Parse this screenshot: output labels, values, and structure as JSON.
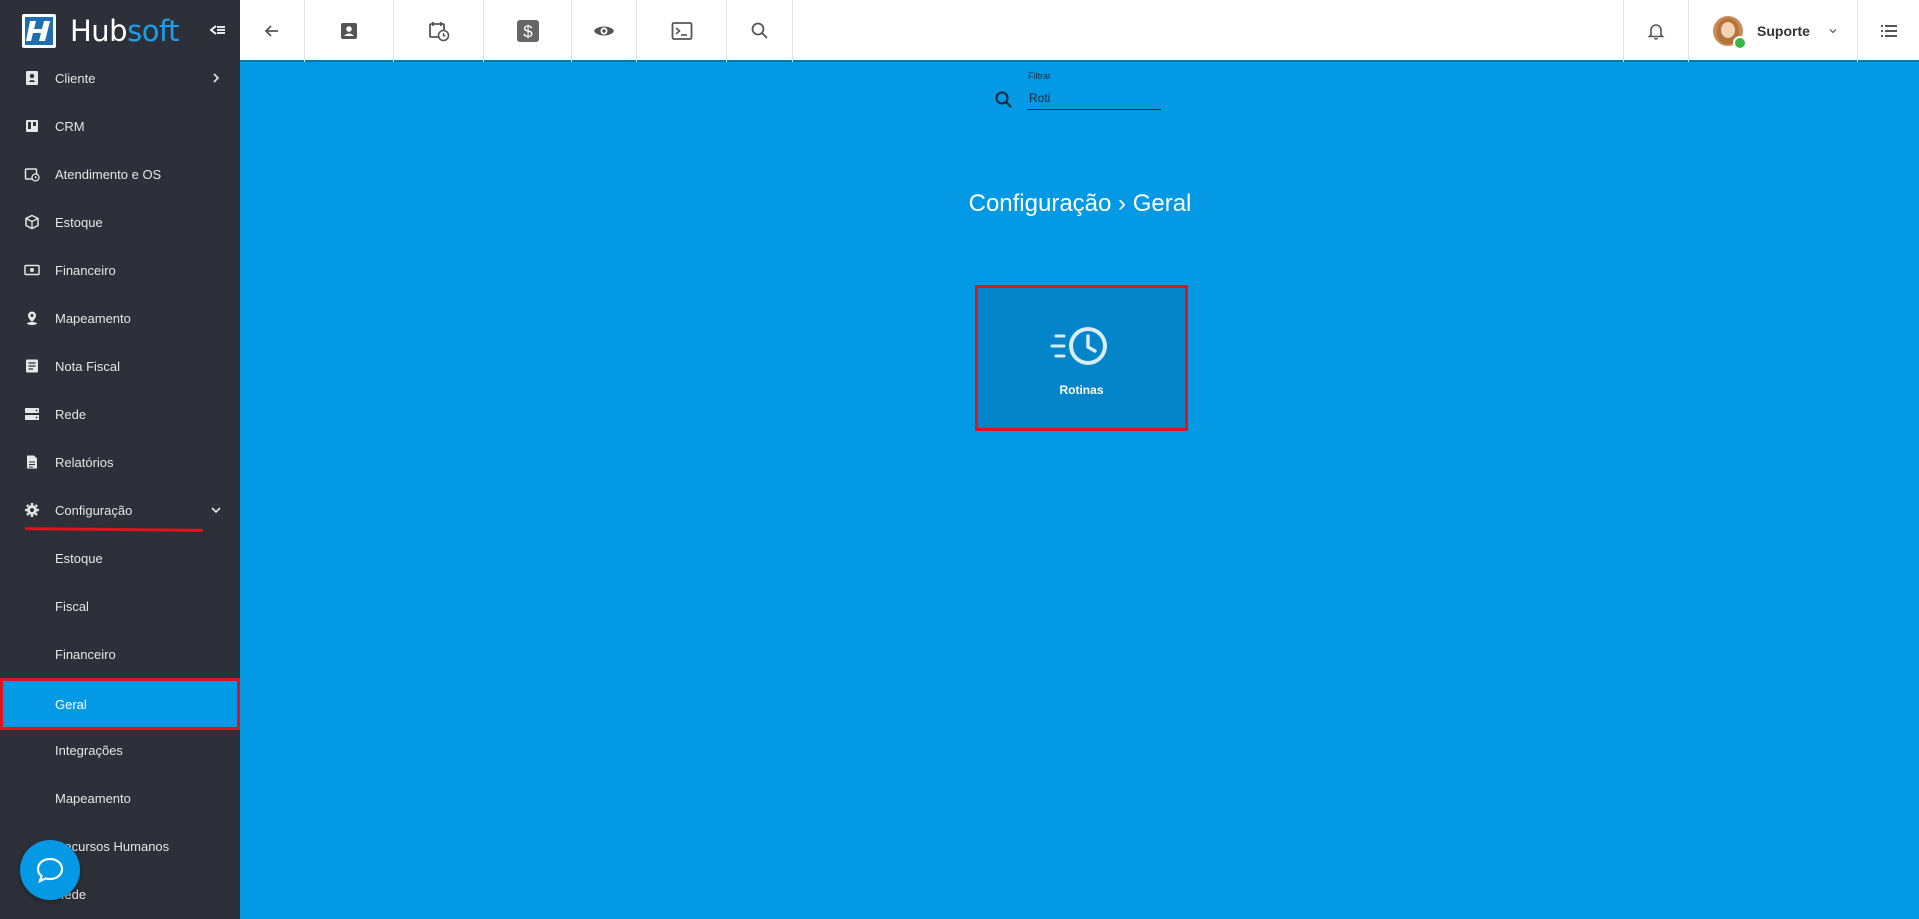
{
  "brand": {
    "name_part1": "Hub",
    "name_part2": "soft"
  },
  "sidebar": {
    "items": [
      {
        "label": "Cliente",
        "icon": "contact-card-icon"
      },
      {
        "label": "CRM",
        "icon": "trello-board-icon"
      },
      {
        "label": "Atendimento e OS",
        "icon": "calendar-clock-icon"
      },
      {
        "label": "Estoque",
        "icon": "box-icon"
      },
      {
        "label": "Financeiro",
        "icon": "money-icon"
      },
      {
        "label": "Mapeamento",
        "icon": "map-pin-icon"
      },
      {
        "label": "Nota Fiscal",
        "icon": "invoice-icon"
      },
      {
        "label": "Rede",
        "icon": "server-icon"
      },
      {
        "label": "Relatórios",
        "icon": "report-icon"
      },
      {
        "label": "Configuração",
        "icon": "gear-icon"
      }
    ],
    "sub_items": [
      {
        "label": "Estoque"
      },
      {
        "label": "Fiscal"
      },
      {
        "label": "Financeiro"
      },
      {
        "label": "Geral"
      },
      {
        "label": "Integrações"
      },
      {
        "label": "Mapeamento"
      },
      {
        "label": "Recursos Humanos"
      },
      {
        "label": "Rede"
      }
    ]
  },
  "topbar": {
    "buttons": [
      "back-arrow-icon",
      "contact-card-icon",
      "calendar-clock-icon",
      "dollar-icon",
      "eye-icon",
      "terminal-icon",
      "search-icon"
    ],
    "user_name": "Suporte"
  },
  "filter": {
    "label": "Filtrar",
    "value": "Roti"
  },
  "breadcrumb": "Configuração › Geral",
  "tiles": [
    {
      "label": "Rotinas",
      "icon": "clock-fast-icon"
    }
  ],
  "colors": {
    "accent": "#0399e4",
    "sidebar": "#2d3038",
    "highlight": "#e0141e"
  }
}
